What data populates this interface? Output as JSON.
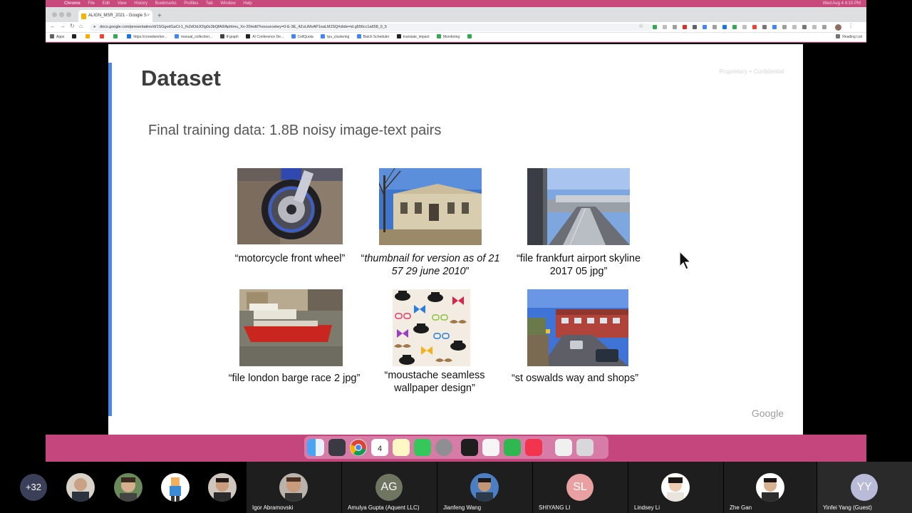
{
  "mac_menubar": {
    "items": [
      "Chrome",
      "File",
      "Edit",
      "View",
      "History",
      "Bookmarks",
      "Profiles",
      "Tab",
      "Window",
      "Help"
    ],
    "clock": "Wed Aug 4  4:10 PM"
  },
  "browser": {
    "tab_title": "ALIGN_MSR_2021 - Google S",
    "tab_close": "×",
    "new_tab": "+",
    "url": "docs.google.com/presentation/d/1SGgvdGaCt-1_fn2dOdJOIg0z3bQfA6lAphlmu_Xv-20/edit?resourcekey=0-E-3E_4ZuLiMvAP1eaLMJSQ#slide=id.g556cc1a658_0_5",
    "bookmarks": [
      "Apps",
      "https://crowdworker...",
      "manual_collection...",
      "tf-graph",
      "AI Conference De...",
      "CellQuota",
      "tpu_clustering",
      "Batch Scheduler",
      "translate_impact",
      "Monitoring"
    ],
    "reading_list": "Reading List"
  },
  "slide": {
    "title": "Dataset",
    "confidential_note": "Proprietary + Confidential",
    "subtitle": "Final training data: 1.8B noisy image-text pairs",
    "footer_logo": "Google",
    "examples": [
      {
        "image": "motorcycle-front-wheel-photo",
        "caption": "“motorcycle front wheel”"
      },
      {
        "image": "library-building-photo",
        "caption_open": "“",
        "caption_italic": "thumbnail for version as of 21 57 29 june 2010",
        "caption_close": "”"
      },
      {
        "image": "frankfurt-airport-photo",
        "caption": "“file frankfurt airport skyline 2017 05 jpg”"
      },
      {
        "image": "london-barge-photo",
        "caption": "“file london barge race 2 jpg”"
      },
      {
        "image": "moustache-wallpaper-pattern",
        "caption": "“moustache seamless wallpaper design”"
      },
      {
        "image": "street-shops-photo",
        "caption": "“st oswalds way and shops”"
      }
    ]
  },
  "dock": {
    "calendar_day": "4",
    "calendar_month": "AUG"
  },
  "participants": {
    "overflow_count": "+32",
    "tiles": [
      {
        "name": "Igor Abramovski",
        "initials": ""
      },
      {
        "name": "Amulya Gupta (Aquent LLC)",
        "initials": "AG"
      },
      {
        "name": "Jianfeng Wang",
        "initials": ""
      },
      {
        "name": "SHIYANG LI",
        "initials": "SL"
      },
      {
        "name": "Lindsey Li",
        "initials": ""
      },
      {
        "name": "Zhe Gan",
        "initials": ""
      },
      {
        "name": "Yinfei Yang (Guest)",
        "initials": "YY"
      }
    ]
  },
  "colors": {
    "desktop": "#c0447a",
    "slide_accent": "#4a86e8",
    "avatar_overflow": "#3c3f58",
    "avatar_ag": "#6f7561",
    "avatar_sl": "#e8a0a0",
    "avatar_yy": "#b9bbd9"
  }
}
